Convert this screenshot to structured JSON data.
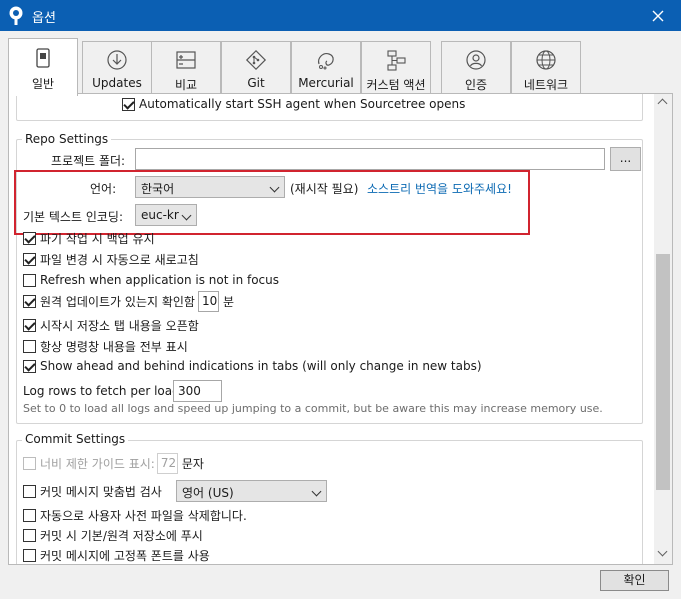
{
  "window": {
    "title": "옵션",
    "close_icon": "close-icon",
    "app_icon": "sourcetree-icon",
    "title_color": "#0b5fb3"
  },
  "tabs": [
    {
      "label": "일반",
      "icon": "switch-icon",
      "active": true
    },
    {
      "label": "Updates",
      "icon": "download-icon",
      "active": false
    },
    {
      "label": "비교",
      "icon": "diff-icon",
      "active": false
    },
    {
      "label": "Git",
      "icon": "git-icon",
      "active": false
    },
    {
      "label": "Mercurial",
      "icon": "mercurial-icon",
      "active": false
    },
    {
      "label": "커스텀 액션",
      "icon": "custom-action-icon",
      "active": false
    },
    {
      "label": "인증",
      "icon": "auth-icon",
      "active": false
    },
    {
      "label": "네트워크",
      "icon": "network-icon",
      "active": false
    }
  ],
  "top_partial": {
    "ssh_agent_label": "Automatically start SSH agent when Sourcetree opens",
    "ssh_agent_checked": true
  },
  "repo_settings": {
    "title": "Repo Settings",
    "project_folder_label": "프로젝트 폴더:",
    "project_folder_value": "",
    "browse_button": "...",
    "language_label": "언어:",
    "language_value": "한국어",
    "restart_note": "(재시작 필요)",
    "translate_link": "소스트리 번역을 도와주세요!",
    "encoding_label": "기본 텍스트 인코딩:",
    "encoding_value": "euc-kr",
    "highlight_color": "#d1242f",
    "checkboxes": [
      {
        "label": "파기 작업 시 백업 유지",
        "checked": true
      },
      {
        "label": "파일 변경 시 자동으로 새로고침",
        "checked": true
      },
      {
        "label": "Refresh when application is not in focus",
        "checked": false
      }
    ],
    "update_check_prefix": "원격 업데이트가 있는지 확인함",
    "update_check_checked": true,
    "update_check_minutes": "10",
    "update_check_unit": "분",
    "more_checkboxes": [
      {
        "label": "시작시 저장소 탭 내용을 오픈함",
        "checked": true
      },
      {
        "label": "항상 명령창 내용을 전부 표시",
        "checked": false
      },
      {
        "label": "Show ahead and behind indications in tabs (will only change in new tabs)",
        "checked": true
      }
    ],
    "log_rows_label": "Log rows to fetch per load:",
    "log_rows_value": "300",
    "log_rows_note": "Set to 0 to load all logs and speed up jumping to a commit, but be aware this may increase memory use."
  },
  "commit_settings": {
    "title": "Commit Settings",
    "width_guide_label": "너비 제한 가이드 표시:",
    "width_guide_value": "72",
    "width_guide_unit": "문자",
    "width_guide_checked": false,
    "spellcheck_label": "커밋 메시지 맞춤법 검사",
    "spellcheck_checked": false,
    "spellcheck_language": "영어 (US)",
    "checkboxes": [
      {
        "label": "자동으로 사용자 사전 파일을 삭제합니다.",
        "checked": false
      },
      {
        "label": "커밋 시 기본/원격 저장소에 푸시",
        "checked": false
      },
      {
        "label": "커밋 메시지에 고정폭 폰트를 사용",
        "checked": false
      }
    ]
  },
  "footer": {
    "ok_button": "확인"
  }
}
